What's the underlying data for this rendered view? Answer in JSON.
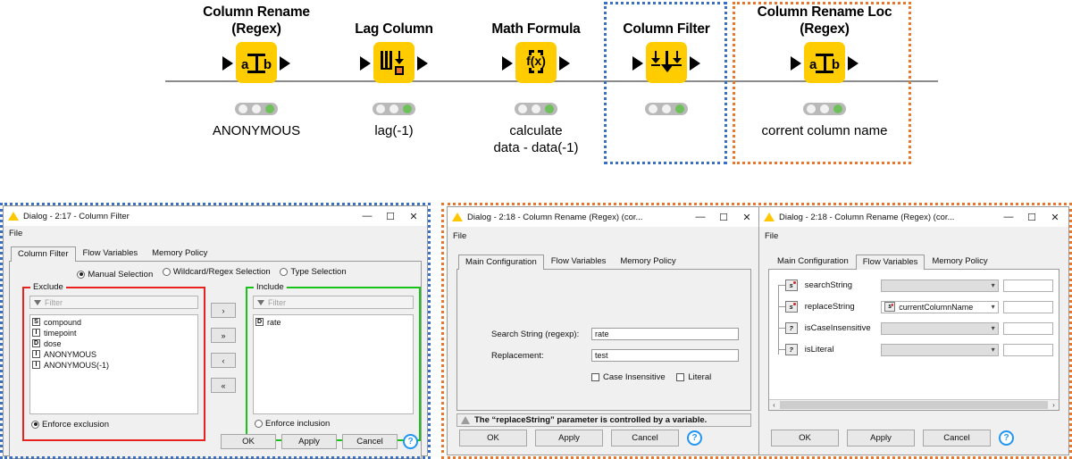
{
  "workflow": {
    "nodes": [
      {
        "title_line1": "Column Rename",
        "title_line2": "(Regex)",
        "icon": "rename-regex-icon",
        "sub_line1": "ANONYMOUS",
        "sub_line2": "",
        "status": "executed"
      },
      {
        "title_line1": "Lag Column",
        "title_line2": "",
        "icon": "lag-column-icon",
        "sub_line1": "lag(-1)",
        "sub_line2": "",
        "status": "executed"
      },
      {
        "title_line1": "Math Formula",
        "title_line2": "",
        "icon": "math-formula-icon",
        "sub_line1": "calculate",
        "sub_line2": "data - data(-1)",
        "status": "executed"
      },
      {
        "title_line1": "Column Filter",
        "title_line2": "",
        "icon": "column-filter-icon",
        "sub_line1": "",
        "sub_line2": "",
        "status": "executed"
      },
      {
        "title_line1": "Column Rename Loc",
        "title_line2": "(Regex)",
        "icon": "rename-regex-icon",
        "sub_line1": "corrent column name",
        "sub_line2": "",
        "status": "executed"
      }
    ],
    "highlights": {
      "blue_color": "#3A6FC4",
      "orange_color": "#E8762C"
    }
  },
  "column_filter_dialog": {
    "title": "Dialog - 2:17 - Column Filter",
    "menu": {
      "file": "File"
    },
    "window_controls": {
      "minimize": "—",
      "maximize": "☐",
      "close": "✕"
    },
    "tabs": [
      {
        "label": "Column Filter",
        "active": true
      },
      {
        "label": "Flow Variables",
        "active": false
      },
      {
        "label": "Memory Policy",
        "active": false
      }
    ],
    "selection_modes": [
      {
        "label": "Manual Selection",
        "selected": true
      },
      {
        "label": "Wildcard/Regex Selection",
        "selected": false
      },
      {
        "label": "Type Selection",
        "selected": false
      }
    ],
    "exclude": {
      "group_label": "Exclude",
      "filter_placeholder": "Filter",
      "items": [
        {
          "type": "S",
          "name": "compound"
        },
        {
          "type": "I",
          "name": "timepoint"
        },
        {
          "type": "D",
          "name": "dose"
        },
        {
          "type": "I",
          "name": "ANONYMOUS"
        },
        {
          "type": "I",
          "name": "ANONYMOUS(-1)"
        }
      ],
      "enforce_label": "Enforce exclusion",
      "enforce_selected": true,
      "border_color": "#e8231f"
    },
    "include": {
      "group_label": "Include",
      "filter_placeholder": "Filter",
      "items": [
        {
          "type": "D",
          "name": "rate"
        }
      ],
      "enforce_label": "Enforce inclusion",
      "enforce_selected": false,
      "border_color": "#18c318"
    },
    "transfer_buttons": [
      {
        "label": "›",
        "name": "add-selected-button"
      },
      {
        "label": "»",
        "name": "add-all-button"
      },
      {
        "label": "‹",
        "name": "remove-selected-button"
      },
      {
        "label": "«",
        "name": "remove-all-button"
      }
    ],
    "buttons": {
      "ok": "OK",
      "apply": "Apply",
      "cancel": "Cancel",
      "help": "?"
    }
  },
  "rename_main_dialog": {
    "title": "Dialog - 2:18 - Column Rename (Regex) (cor...",
    "menu": {
      "file": "File"
    },
    "window_controls": {
      "minimize": "—",
      "maximize": "☐",
      "close": "✕"
    },
    "tabs": [
      {
        "label": "Main Configuration",
        "active": true
      },
      {
        "label": "Flow Variables",
        "active": false
      },
      {
        "label": "Memory Policy",
        "active": false
      }
    ],
    "fields": [
      {
        "label": "Search String (regexp):",
        "value": "rate"
      },
      {
        "label": "Replacement:",
        "value": "test"
      }
    ],
    "checkboxes": [
      {
        "label": "Case Insensitive",
        "checked": false
      },
      {
        "label": "Literal",
        "checked": false
      }
    ],
    "warning": "The “replaceString” parameter is controlled by a variable.",
    "buttons": {
      "ok": "OK",
      "apply": "Apply",
      "cancel": "Cancel",
      "help": "?"
    }
  },
  "rename_flowvars_dialog": {
    "title": "Dialog - 2:18 - Column Rename (Regex) (cor...",
    "menu": {
      "file": "File"
    },
    "window_controls": {
      "minimize": "—",
      "maximize": "☐",
      "close": "✕"
    },
    "tabs": [
      {
        "label": "Main Configuration",
        "active": false
      },
      {
        "label": "Flow Variables",
        "active": true
      },
      {
        "label": "Memory Policy",
        "active": false
      }
    ],
    "variables": [
      {
        "icon": "s",
        "name": "searchString",
        "value": "",
        "value_icon": ""
      },
      {
        "icon": "s",
        "name": "replaceString",
        "value": "currentColumnName",
        "value_icon": "s"
      },
      {
        "icon": "?",
        "name": "isCaseInsensitive",
        "value": "",
        "value_icon": ""
      },
      {
        "icon": "?",
        "name": "isLiteral",
        "value": "",
        "value_icon": ""
      }
    ],
    "scrollbar": {
      "left": "‹",
      "right": "›"
    },
    "buttons": {
      "ok": "OK",
      "apply": "Apply",
      "cancel": "Cancel",
      "help": "?"
    }
  }
}
